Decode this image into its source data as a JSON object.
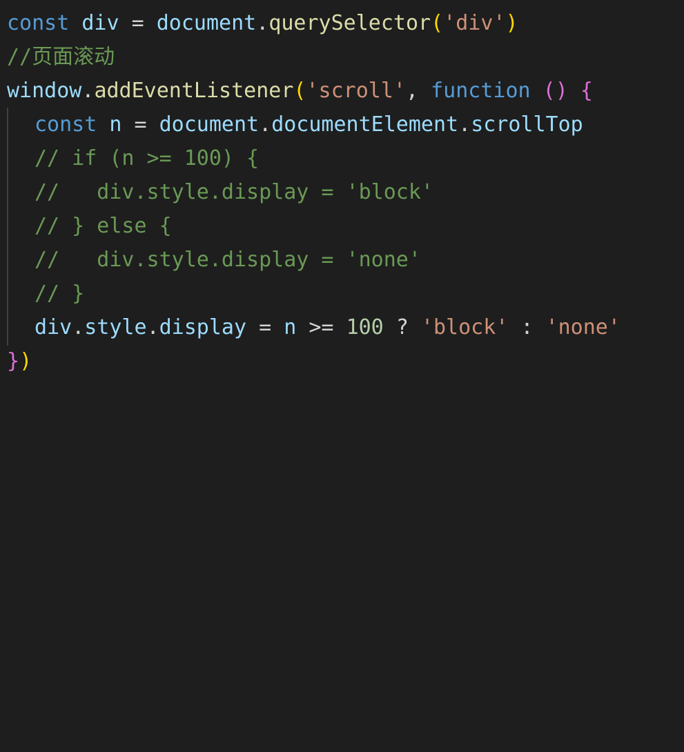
{
  "editor": {
    "language": "javascript",
    "theme_colors": {
      "background": "#1e1e1e",
      "keyword": "#569cd6",
      "variable": "#9cdcfe",
      "function": "#dcdcaa",
      "string": "#ce9178",
      "number": "#b5cea8",
      "comment": "#6a9955",
      "bracket_level1": "#ffd700",
      "bracket_level2": "#da70d6",
      "bracket_level3": "#179fff"
    },
    "lines": {
      "l1": {
        "kw_const": "const",
        "var_div": "div",
        "op_eq": "=",
        "obj_document": "document",
        "dot": ".",
        "fn_querySelector": "querySelector",
        "paren_open": "(",
        "str_div": "'div'",
        "paren_close": ")"
      },
      "l2": {
        "comment": "//页面滚动"
      },
      "l3": {
        "obj_window": "window",
        "dot": ".",
        "fn_addEventListener": "addEventListener",
        "paren_open": "(",
        "str_scroll": "'scroll'",
        "comma": ",",
        "kw_function": "function",
        "params": "()",
        "brace_open": "{"
      },
      "l4": {
        "kw_const": "const",
        "var_n": "n",
        "op_eq": "=",
        "obj_document": "document",
        "dot1": ".",
        "prop_documentElement": "documentElement",
        "dot2": ".",
        "prop_scrollTop": "scrollTop"
      },
      "l5": {
        "comment": "// if (n >= 100) {"
      },
      "l6": {
        "comment": "//   div.style.display = 'block'"
      },
      "l7": {
        "comment": "// } else {"
      },
      "l8": {
        "comment": "//   div.style.display = 'none'"
      },
      "l9": {
        "comment": "// }"
      },
      "l10": {
        "var_div": "div",
        "dot1": ".",
        "prop_style": "style",
        "dot2": ".",
        "prop_display": "display",
        "op_eq": "=",
        "var_n": "n",
        "op_gte": ">=",
        "num_100": "100",
        "op_q": "?",
        "str_block": "'block'",
        "op_colon": ":",
        "str_none": "'none'"
      },
      "l11": {
        "brace_close": "}",
        "paren_close": ")"
      }
    }
  }
}
